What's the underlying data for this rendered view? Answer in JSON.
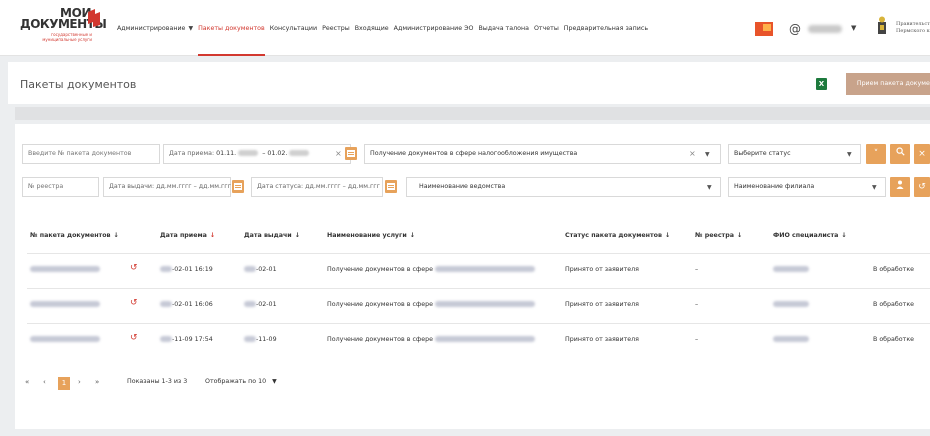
{
  "header": {
    "logo": {
      "line1": "МОИ",
      "line2": "ДОКУМЕНТЫ",
      "sub": "государственные и муниципальные услуги"
    },
    "nav": [
      {
        "label": "Администрирование",
        "dropdown": true
      },
      {
        "label": "Пакеты документов",
        "active": true
      },
      {
        "label": "Консультации"
      },
      {
        "label": "Реестры"
      },
      {
        "label": "Входящие"
      },
      {
        "label": "Администрирование ЭО"
      },
      {
        "label": "Выдача талона"
      },
      {
        "label": "Отчеты"
      },
      {
        "label": "Предварительная запись"
      }
    ],
    "at_symbol": "@",
    "gov_text_line1": "Правительст",
    "gov_text_line2": "Пермского к"
  },
  "title": {
    "text": "Пакеты документов",
    "receive_button": "Прием пакета документов",
    "excel_letter": "X"
  },
  "filters": {
    "package_no_placeholder": "Введите № пакета документов",
    "receive_date_label": "Дата приема:",
    "receive_date_from": "01.11.",
    "receive_date_sep": "– 01.02.",
    "service_value": "Получение документов в сфере налогообложения имущества",
    "status_placeholder": "Выберите статус",
    "registry_placeholder": "№ реестра",
    "issue_date_label": "Дата выдачи:",
    "issue_date_placeholder": "дд.мм.гггг – дд.мм.ггг",
    "status_date_label": "Дата статуса:",
    "status_date_placeholder": "дд.мм.гггг – дд.мм.ггг",
    "department_placeholder": "Наименование ведомства",
    "branch_placeholder": "Наименование филиала"
  },
  "table": {
    "headers": {
      "package_no": "№ пакета документов",
      "receive_date": "Дата приема",
      "issue_date": "Дата выдачи",
      "service": "Наименование услуги",
      "status": "Статус пакета документов",
      "registry": "№ реестра",
      "specialist": "ФИО специалиста",
      "arrow": "↓"
    },
    "rows": [
      {
        "receive_date": "-02-01 16:19",
        "issue_date": "-02-01",
        "service": "Получение документов в сфере",
        "status": "Принято от заявителя",
        "registry": "–",
        "state": "В обработке"
      },
      {
        "receive_date": "-02-01 16:06",
        "issue_date": "-02-01",
        "service": "Получение документов в сфере",
        "status": "Принято от заявителя",
        "registry": "–",
        "state": "В обработке"
      },
      {
        "receive_date": "-11-09 17:54",
        "issue_date": "-11-09",
        "service": "Получение документов в сфере",
        "status": "Принято от заявителя",
        "registry": "–",
        "state": "В обработке"
      }
    ]
  },
  "pagination": {
    "first": "«",
    "prev": "‹",
    "current": "1",
    "next": "›",
    "last": "»",
    "shown": "Показаны 1-3 из 3",
    "per_page": "Отображать по 10"
  },
  "colors": {
    "accent": "#d2382f",
    "orange": "#e7a25b",
    "receive_btn": "#c8a38b"
  }
}
